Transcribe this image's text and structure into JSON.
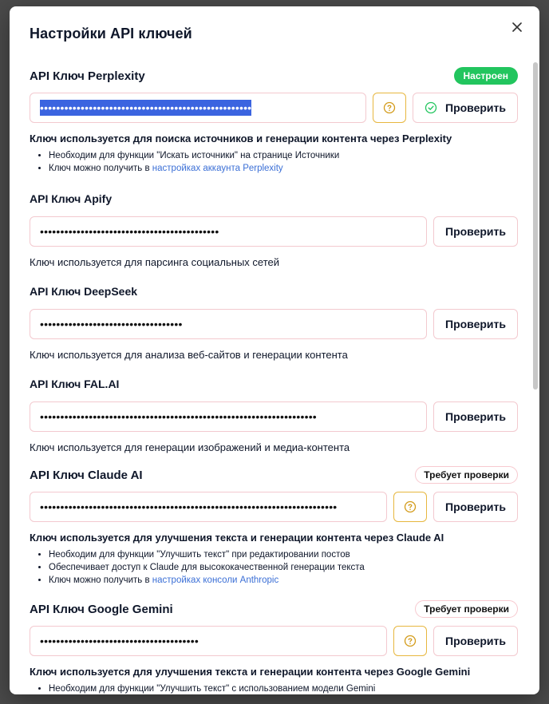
{
  "modal": {
    "title": "Настройки API ключей"
  },
  "sections": {
    "perplexity": {
      "title": "API Ключ Perplexity",
      "badge": "Настроен",
      "key_masked": "••••••••••••••••••••••••••••••••••••••••••••••••••••",
      "check_label": "Проверить",
      "description": "Ключ используется для поиска источников и генерации контента через Perplexity",
      "bullet1": "Необходим для функции \"Искать источники\" на странице Источники",
      "bullet2_prefix": "Ключ можно получить в ",
      "bullet2_link": "настройках аккаунта Perplexity"
    },
    "apify": {
      "title": "API Ключ Apify",
      "key_masked": "••••••••••••••••••••••••••••••••••••••••••••",
      "check_label": "Проверить",
      "description": "Ключ используется для парсинга социальных сетей"
    },
    "deepseek": {
      "title": "API Ключ DeepSeek",
      "key_masked": "•••••••••••••••••••••••••••••••••••",
      "check_label": "Проверить",
      "description": "Ключ используется для анализа веб-сайтов и генерации контента"
    },
    "falai": {
      "title": "API Ключ FAL.AI",
      "key_masked": "••••••••••••••••••••••••••••••••••••••••••••••••••••••••••••••••••••",
      "check_label": "Проверить",
      "description": "Ключ используется для генерации изображений и медиа-контента"
    },
    "claude": {
      "title": "API Ключ Claude AI",
      "badge": "Требует проверки",
      "key_masked": "•••••••••••••••••••••••••••••••••••••••••••••••••••••••••••••••••••••••••",
      "check_label": "Проверить",
      "description": "Ключ используется для улучшения текста и генерации контента через Claude AI",
      "bullet1": "Необходим для функции \"Улучшить текст\" при редактировании постов",
      "bullet2": "Обеспечивает доступ к Claude для высококачественной генерации текста",
      "bullet3_prefix": "Ключ можно получить в ",
      "bullet3_link": "настройках консоли Anthropic"
    },
    "gemini": {
      "title": "API Ключ Google Gemini",
      "badge": "Требует проверки",
      "key_masked": "•••••••••••••••••••••••••••••••••••••••",
      "check_label": "Проверить",
      "description": "Ключ используется для улучшения текста и генерации контента через Google Gemini",
      "bullet1": "Необходим для функции \"Улучшить текст\" с использованием модели Gemini"
    }
  },
  "colors": {
    "success": "#22c55e",
    "warning_border": "#e7b73f",
    "link": "#3b6fd6",
    "selection": "#3b64e0"
  }
}
